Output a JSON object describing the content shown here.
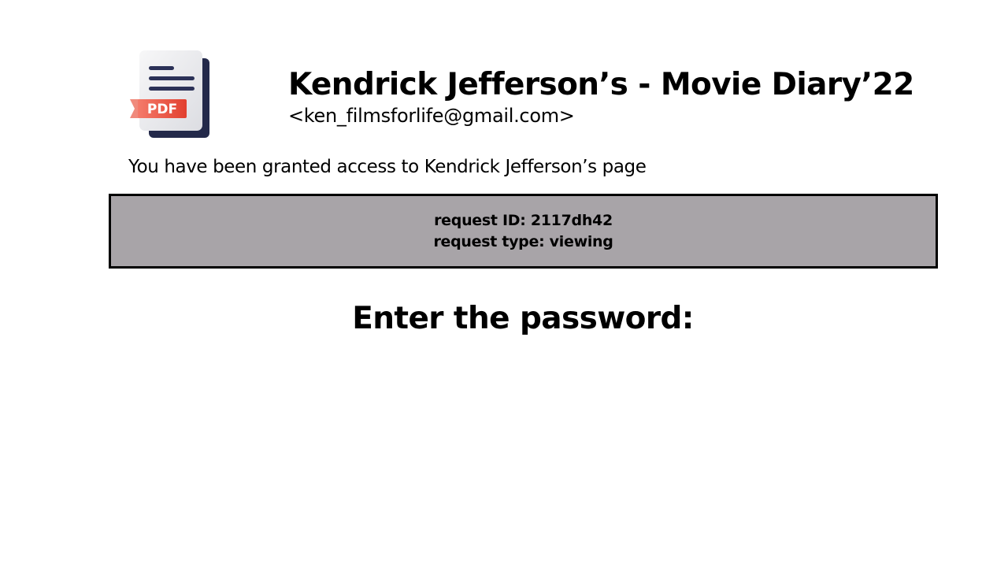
{
  "document": {
    "icon": "pdf-file-icon",
    "icon_badge": "PDF",
    "title": "Kendrick Jefferson’s - Movie Diary’22",
    "email": "<ken_filmsforlife@gmail.com>"
  },
  "access_message": "You have been granted access to Kendrick Jefferson’s page",
  "request": {
    "id_line": "request ID: 2117dh42",
    "type_line": "request type: viewing"
  },
  "password_prompt": "Enter the password:",
  "colors": {
    "request_box_bg": "#a8a4a8",
    "badge_red": "#e8473a",
    "doc_navy": "#23294a"
  }
}
